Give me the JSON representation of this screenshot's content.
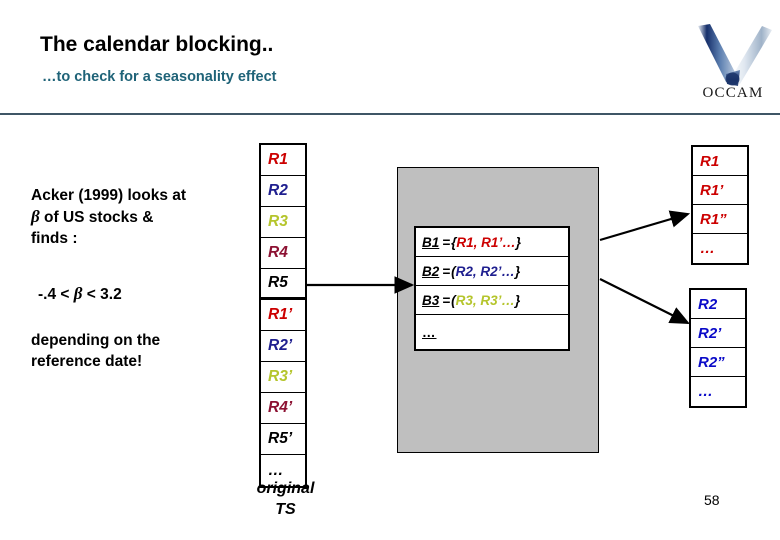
{
  "slide": {
    "title": "The calendar blocking..",
    "subtitle": "…to check for a seasonality effect",
    "page_number": "58",
    "rule_color": "#3f5666",
    "subtitle_color": "#1f6378"
  },
  "logo": {
    "name": "occam-logo",
    "wordmark": "OCCAM"
  },
  "body_text": {
    "paragraph1_line1": "Acker (1999) looks at",
    "paragraph1_beta": "β",
    "paragraph1_line2_rest": " of US stocks &",
    "paragraph1_line3": "finds :",
    "inequality_left": "-.4 < ",
    "inequality_beta": "β",
    "inequality_right": " < 3.2",
    "paragraph3_line1": "depending on  the",
    "paragraph3_line2": "reference date!"
  },
  "original_ts": {
    "caption_line1": "original",
    "caption_line2": "TS",
    "cells": [
      {
        "label": "R1",
        "color": "#cc0000"
      },
      {
        "label": "R2",
        "color": "#1f1f8f"
      },
      {
        "label": "R3",
        "color": "#b5c52d"
      },
      {
        "label": "R4",
        "color": "#8c1132"
      },
      {
        "label": "R5",
        "color": "#000000"
      },
      {
        "label": "R1’",
        "color": "#cc0000"
      },
      {
        "label": "R2’",
        "color": "#1f1f8f"
      },
      {
        "label": "R3’",
        "color": "#b5c52d"
      },
      {
        "label": "R4’",
        "color": "#8c1132"
      },
      {
        "label": "R5’",
        "color": "#000000"
      },
      {
        "label": "…",
        "color": "#000000"
      }
    ]
  },
  "blocks_box": {
    "rows": [
      {
        "name": "B1",
        "eq": "= ",
        "open": "{",
        "members": "R1, R1’…",
        "close": "}",
        "color": "#cc0000"
      },
      {
        "name": "B2",
        "eq": "=",
        "open": "(",
        "members": "R2, R2’…",
        "close": "}",
        "color": "#1f1f8f"
      },
      {
        "name": "B3",
        "eq": "=",
        "open": "(",
        "members": "R3, R3’…",
        "close": "}",
        "color": "#b5c52d"
      },
      {
        "name": "…",
        "eq": "",
        "open": "",
        "members": "",
        "close": "",
        "color": "#000000"
      }
    ]
  },
  "right_stacks": [
    {
      "name": "block-b1-expansion",
      "cells": [
        {
          "label": "R1",
          "color": "#cc0000"
        },
        {
          "label": "R1’",
          "color": "#cc0000"
        },
        {
          "label": "R1”",
          "color": "#cc0000"
        },
        {
          "label": "…",
          "color": "#cc0000"
        }
      ]
    },
    {
      "name": "block-b2-expansion",
      "cells": [
        {
          "label": "R2",
          "color": "#0a0ac8"
        },
        {
          "label": "R2’",
          "color": "#0a0ac8"
        },
        {
          "label": "R2”",
          "color": "#0a0ac8"
        },
        {
          "label": "…",
          "color": "#0a0ac8"
        }
      ]
    }
  ]
}
